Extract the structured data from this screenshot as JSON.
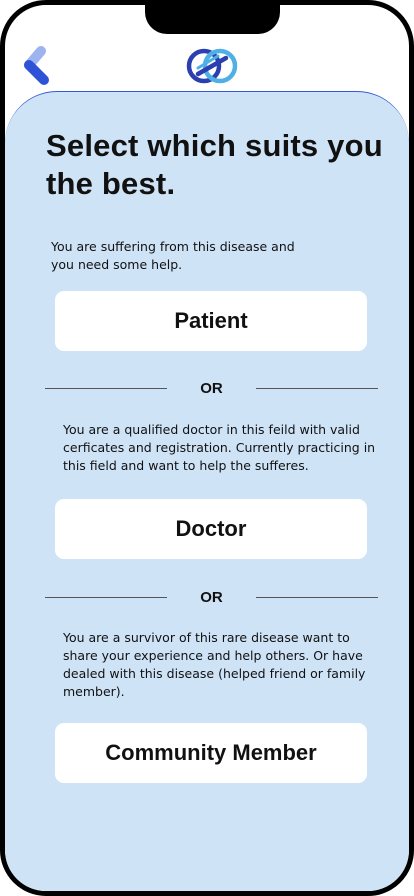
{
  "header": {
    "back_icon": "back-chevron-icon",
    "logo_icon": "infinity-logo-icon"
  },
  "page": {
    "title": "Select which suits you the best."
  },
  "options": [
    {
      "description": "You are suffering from this disease and you need some help.",
      "button_label": "Patient"
    },
    {
      "description": "You are a qualified doctor in this feild with valid cerficates and registration. Currently practicing in this field and want to help the sufferes.",
      "button_label": "Doctor"
    },
    {
      "description": "You are a survivor of this rare disease want to share your experience and help others. Or have dealed with this disease (helped friend or family member).",
      "button_label": "Community Member"
    }
  ],
  "separator_label": "OR",
  "colors": {
    "background": "#cfe3f7",
    "accent": "#3559d6",
    "logo_dark": "#2c3fb0",
    "logo_light": "#4fb0e6",
    "button_bg": "#ffffff"
  }
}
